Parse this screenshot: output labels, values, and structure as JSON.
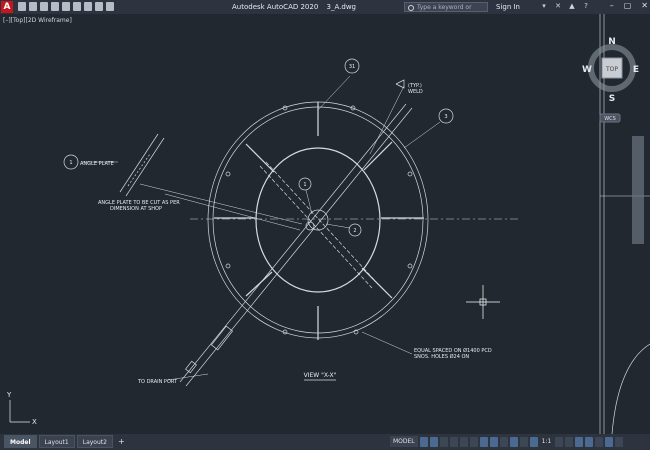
{
  "titlebar": {
    "logo": "A",
    "app_name": "Autodesk AutoCAD 2020",
    "file_name": "3_A.dwg",
    "search_placeholder": "Type a keyword or phrase",
    "sign_in": "Sign In"
  },
  "viewport": {
    "label": "[–][Top][2D Wireframe]"
  },
  "viewcube": {
    "north": "N",
    "south": "S",
    "east": "E",
    "west": "W",
    "face": "TOP",
    "wcs": "WCS"
  },
  "drawing": {
    "balloons": [
      "1",
      "31",
      "3",
      "1",
      "2"
    ],
    "angle_plate": "ANGLE PLATE",
    "angle_plate_note_1": "ANGLE PLATE TO BE CUT AS PER",
    "angle_plate_note_2": "DIMENSION AT SHOP",
    "typ_weld_1": "(TYP.)",
    "typ_weld_2": "WELD",
    "equal_spaced_1": "EQUAL SPACED ON Ø1400 PCD",
    "equal_spaced_2": "SNOS. HOLES Ø24 ON",
    "drain_port": "TO DRAIN PORT",
    "view_title": "VIEW \"X-X\""
  },
  "ucs": {
    "x": "X",
    "y": "Y"
  },
  "statusbar": {
    "tabs": [
      "Model",
      "Layout1",
      "Layout2"
    ],
    "add_tab": "+",
    "model_button": "MODEL",
    "scale": "1:1"
  }
}
